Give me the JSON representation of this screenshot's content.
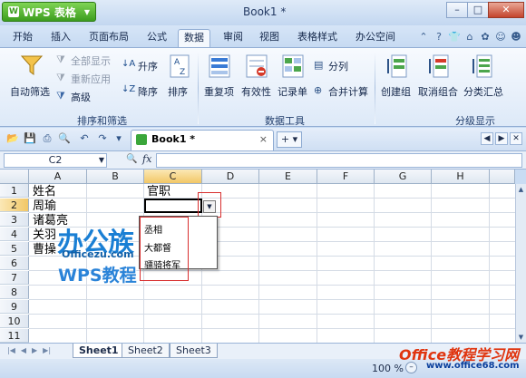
{
  "app": {
    "app_button_label": "WPS 表格",
    "window_title": "Book1 *",
    "window_controls": {
      "minimize": "–",
      "maximize": "□",
      "close": "✕"
    }
  },
  "menu": {
    "tabs": [
      "开始",
      "插入",
      "页面布局",
      "公式",
      "数据",
      "审阅",
      "视图",
      "表格样式",
      "办公空间"
    ],
    "active_tab": "数据"
  },
  "ribbon": {
    "autofilter": "自动筛选",
    "show_all": "全部显示",
    "reapply": "重新应用",
    "advanced": "高级",
    "sort_asc": "升序",
    "sort_desc": "降序",
    "sort": "排序",
    "group_sort_filter": "排序和筛选",
    "duplicates": "重复项",
    "validity": "有效性",
    "record_form": "记录单",
    "text_to_columns": "分列",
    "consolidate": "合并计算",
    "group_data_tools": "数据工具",
    "create_group": "创建组",
    "ungroup": "取消组合",
    "subtotal": "分类汇总",
    "group_outline": "分级显示"
  },
  "document_tab": {
    "label": "Book1 *",
    "close": "×",
    "new_tab": "+ ▾"
  },
  "formula_bar": {
    "name_box": "C2",
    "fx_label": "fx",
    "formula": ""
  },
  "sheet": {
    "columns": [
      "A",
      "B",
      "C",
      "D",
      "E",
      "F",
      "G",
      "H"
    ],
    "selected_column": "C",
    "rows": [
      "1",
      "2",
      "3",
      "4",
      "5",
      "6",
      "7",
      "8",
      "9",
      "10",
      "11"
    ],
    "selected_row": "2",
    "cells": {
      "A1": "姓名",
      "C1": "官职",
      "A2": "周瑜",
      "A3": "诸葛亮",
      "A4": "关羽",
      "A5": "曹操"
    },
    "dropdown_options": [
      "丞相",
      "大都督",
      "骠骑将军"
    ]
  },
  "watermark": {
    "brand_cn": "办公族",
    "brand_url": "Officezu.com",
    "brand_tagline": "WPS教程"
  },
  "sheet_tabs": [
    "Sheet1",
    "Sheet2",
    "Sheet3"
  ],
  "active_sheet": "Sheet1",
  "status": {
    "zoom": "100 %",
    "zoom_minus": "–"
  },
  "site_watermark": {
    "title": "Office教程学习网",
    "url": "www.office68.com"
  }
}
